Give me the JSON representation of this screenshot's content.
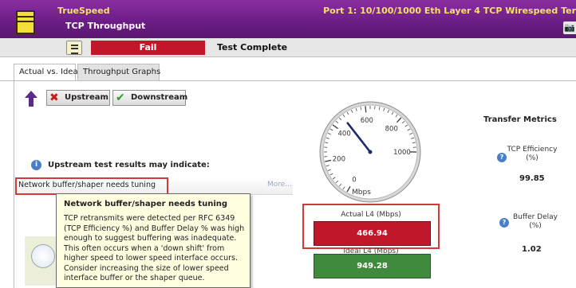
{
  "header": {
    "app_name": "TrueSpeed",
    "subtitle": "TCP Throughput",
    "port_info": "Port 1: 10/100/1000 Eth Layer 4 TCP Wirespeed Ter",
    "icons": [
      "app-notepad-icon",
      "camera-icon"
    ]
  },
  "status": {
    "result": "Fail",
    "message": "Test Complete",
    "result_color": "#c0172a"
  },
  "tabs": [
    {
      "label": "Actual vs. Ideal",
      "active": true
    },
    {
      "label": "Throughput Graphs",
      "active": false
    }
  ],
  "direction": {
    "upstream_label": "Upstream",
    "downstream_label": "Downstream",
    "upstream_icon": "red-x-icon",
    "downstream_icon": "green-check-icon"
  },
  "analysis": {
    "heading": "Upstream test results may indicate:",
    "result_item": "Network buffer/shaper needs tuning",
    "more_link": "More..."
  },
  "tooltip": {
    "title": "Network buffer/shaper needs tuning",
    "body": "TCP retransmits were detected per RFC 6349 (TCP Efficiency %) and Buffer Delay % was high enough to suggest buffering was inadequate. This often occurs when a 'down shift' from higher speed to lower speed interface occurs. Consider increasing the size of lower speed interface buffer or the shaper queue."
  },
  "gauge": {
    "unit_label": "Mbps",
    "tick_labels": [
      "0",
      "200",
      "400",
      "600",
      "800",
      "1000"
    ],
    "min": 0,
    "max": 1000,
    "needle_value": 466.94
  },
  "readouts": {
    "actual_label": "Actual L4 (Mbps)",
    "actual_value": "466.94",
    "ideal_label": "Ideal L4 (Mbps)",
    "ideal_value": "949.28",
    "actual_color": "#c0172a",
    "ideal_color": "#3f8a3c"
  },
  "metrics": {
    "title": "Transfer Metrics",
    "items": [
      {
        "name": "TCP Efficiency (%)",
        "value": "99.85"
      },
      {
        "name": "Buffer Delay (%)",
        "value": "1.02"
      }
    ]
  }
}
